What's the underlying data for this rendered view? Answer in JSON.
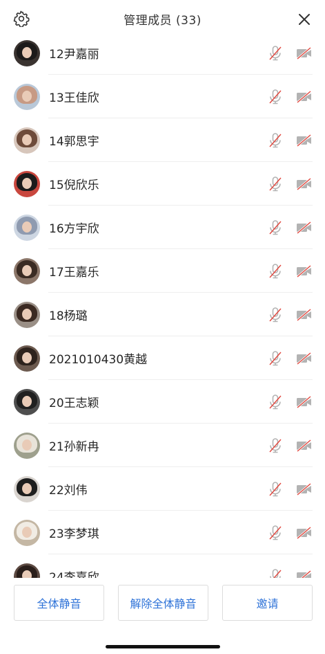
{
  "header": {
    "title": "管理成员 (33)",
    "settings_icon": "gear-icon",
    "close_icon": "close-icon"
  },
  "members": [
    {
      "name": "12尹嘉丽",
      "mic": "mic-muted-icon",
      "camera": "camera-off-icon",
      "avatar_bg": "#3a3330",
      "hair": "#1c1a1a"
    },
    {
      "name": "13王佳欣",
      "mic": "mic-muted-icon",
      "camera": "camera-off-icon",
      "avatar_bg": "#b9c8d8",
      "hair": "#c79a84"
    },
    {
      "name": "14郭思宇",
      "mic": "mic-muted-icon",
      "camera": "camera-off-icon",
      "avatar_bg": "#d7c6bb",
      "hair": "#6e4b3a"
    },
    {
      "name": "15倪欣乐",
      "mic": "mic-muted-icon",
      "camera": "camera-off-icon",
      "avatar_bg": "#c9473e",
      "hair": "#1b1b1b"
    },
    {
      "name": "16方宇欣",
      "mic": "mic-muted-icon",
      "camera": "camera-off-icon",
      "avatar_bg": "#cdd6e2",
      "hair": "#8f9bb0"
    },
    {
      "name": "17王嘉乐",
      "mic": "mic-muted-icon",
      "camera": "camera-off-icon",
      "avatar_bg": "#8b7669",
      "hair": "#3a2b23"
    },
    {
      "name": "18杨璐",
      "mic": "mic-muted-icon",
      "camera": "camera-off-icon",
      "avatar_bg": "#9a8f86",
      "hair": "#3b2a22"
    },
    {
      "name": "2021010430黄越",
      "mic": "mic-muted-icon",
      "camera": "camera-off-icon",
      "avatar_bg": "#6c5a4f",
      "hair": "#2e231d"
    },
    {
      "name": "20王志颖",
      "mic": "mic-muted-icon",
      "camera": "camera-off-icon",
      "avatar_bg": "#4e4e4e",
      "hair": "#202020"
    },
    {
      "name": "21孙新冉",
      "mic": "mic-muted-icon",
      "camera": "camera-off-icon",
      "avatar_bg": "#9ea08d",
      "hair": "#e8e3d9"
    },
    {
      "name": "22刘伟",
      "mic": "mic-muted-icon",
      "camera": "camera-off-icon",
      "avatar_bg": "#d9d4cf",
      "hair": "#1e1e1e"
    },
    {
      "name": "23李梦琪",
      "mic": "mic-muted-icon",
      "camera": "camera-off-icon",
      "avatar_bg": "#c4b7a4",
      "hair": "#f1ece4"
    },
    {
      "name": "24李嘉欣",
      "mic": "mic-muted-icon",
      "camera": "camera-off-icon",
      "avatar_bg": "#5d4a42",
      "hair": "#2a1e1a"
    }
  ],
  "footer": {
    "mute_all_label": "全体静音",
    "unmute_all_label": "解除全体静音",
    "invite_label": "邀请"
  },
  "colors": {
    "accent": "#2f73d8",
    "muted_red": "#e2453c",
    "icon_gray": "#b3b3b3"
  }
}
